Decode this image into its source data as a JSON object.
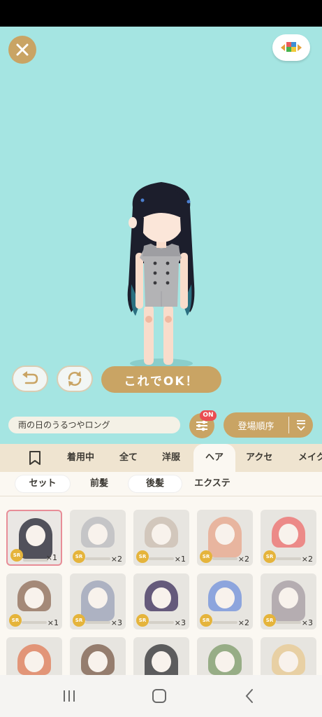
{
  "preview": {
    "ok_label": "これでOK！",
    "bg_color": "#a5e5e2",
    "accent_color": "#c9a464"
  },
  "item_name": "雨の日のうるつやロング",
  "filter_badge": "ON",
  "sort_label": "登場順序",
  "categories": [
    {
      "label": "着用中"
    },
    {
      "label": "全て"
    },
    {
      "label": "洋服"
    },
    {
      "label": "ヘア"
    },
    {
      "label": "アクセ"
    },
    {
      "label": "メイク"
    }
  ],
  "subcategories": [
    {
      "label": "セット"
    },
    {
      "label": "前髪"
    },
    {
      "label": "後髪"
    },
    {
      "label": "エクステ"
    }
  ],
  "items": [
    {
      "rarity": "SR",
      "count": "×1",
      "hair": "#1d1f2e",
      "selected": true
    },
    {
      "rarity": "SR",
      "count": "×2",
      "hair": "#b9b9bf"
    },
    {
      "rarity": "SR",
      "count": "×1",
      "hair": "#cbbcb0"
    },
    {
      "rarity": "SR",
      "count": "×2",
      "hair": "#e8a48a"
    },
    {
      "rarity": "SR",
      "count": "×2",
      "hair": "#ee6b6b"
    },
    {
      "rarity": "SR",
      "count": "×1",
      "hair": "#8d6a55"
    },
    {
      "rarity": "SR",
      "count": "×3",
      "hair": "#9aa0b8"
    },
    {
      "rarity": "SR",
      "count": "×3",
      "hair": "#3a2b5a"
    },
    {
      "rarity": "SR",
      "count": "×2",
      "hair": "#6f8fdc"
    },
    {
      "rarity": "SR",
      "count": "×3",
      "hair": "#a49aa2"
    },
    {
      "rarity": "",
      "count": "",
      "hair": "#e07a55"
    },
    {
      "rarity": "",
      "count": "",
      "hair": "#7a5a48"
    },
    {
      "rarity": "",
      "count": "",
      "hair": "#2e2e32"
    },
    {
      "rarity": "",
      "count": "",
      "hair": "#7c9a68"
    },
    {
      "rarity": "",
      "count": "",
      "hair": "#e8c890"
    }
  ]
}
